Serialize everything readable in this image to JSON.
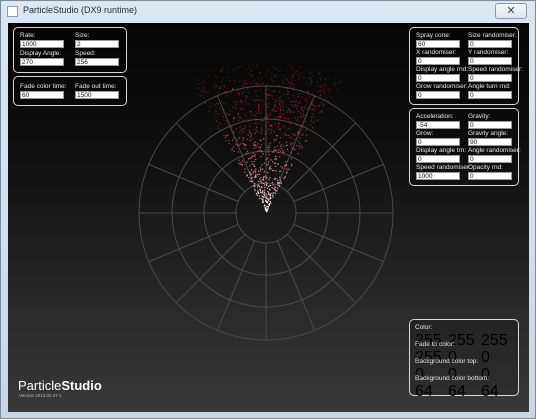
{
  "window": {
    "title": "ParticleStudio (DX9 runtime)",
    "close_glyph": "✕"
  },
  "panel_basic": {
    "rate_label": "Rate:",
    "rate_value": "1000",
    "size_label": "Size:",
    "size_value": "2",
    "angle_label": "Display Angle:",
    "angle_value": "270",
    "speed_label": "Speed:",
    "speed_value": "256"
  },
  "panel_fade": {
    "in_label": "Fade color time:",
    "in_value": "60",
    "out_label": "Fade out time:",
    "out_value": "1500"
  },
  "panel_random": {
    "cone_label": "Spray cone:",
    "cone_value": "60",
    "sizer_label": "Size randomiser:",
    "sizer_value": "0",
    "xr_label": "X randomiser:",
    "xr_value": "0",
    "yr_label": "Y randomiser:",
    "yr_value": "0",
    "dar_label": "Display angle rnd:",
    "dar_value": "0",
    "sr_label": "Speed randomiser:",
    "sr_value": "0",
    "gr_label": "Grow randomiser:",
    "gr_value": "0",
    "atr_label": "Angle turn rnd:",
    "atr_value": "0"
  },
  "panel_physics": {
    "acc_label": "Acceleration:",
    "acc_value": "-54",
    "grav_label": "Gravity:",
    "grav_value": "0",
    "grow_label": "Grow:",
    "grow_value": "0",
    "ga_label": "Gravity angle:",
    "ga_value": "90",
    "dat_label": "Display angle trn:",
    "dat_value": "0",
    "ar_label": "Angle randomiser:",
    "ar_value": "0",
    "spr_label": "Speed randomiser:",
    "spr_value": "1000",
    "or_label": "Opacity rnd:",
    "or_value": "0"
  },
  "panel_color": {
    "color_label": "Color:",
    "color_r": "255",
    "color_g": "255",
    "color_b": "255",
    "fade_label": "Fade to color:",
    "fade_r": "255",
    "fade_g": "0",
    "fade_b": "0",
    "top_label": "Background color top:",
    "top_r": "0",
    "top_g": "0",
    "top_b": "0",
    "bot_label": "Background color bottom:",
    "bot_r": "64",
    "bot_g": "64",
    "bot_b": "64"
  },
  "branding": {
    "logo_light": "Particle",
    "logo_bold": "Studio",
    "version": "Version 2013.02.07 A"
  },
  "colors": {
    "panel_border": "#d8d8d8",
    "particle_core": "#ffffff",
    "particle_fade": "#c0303c"
  }
}
